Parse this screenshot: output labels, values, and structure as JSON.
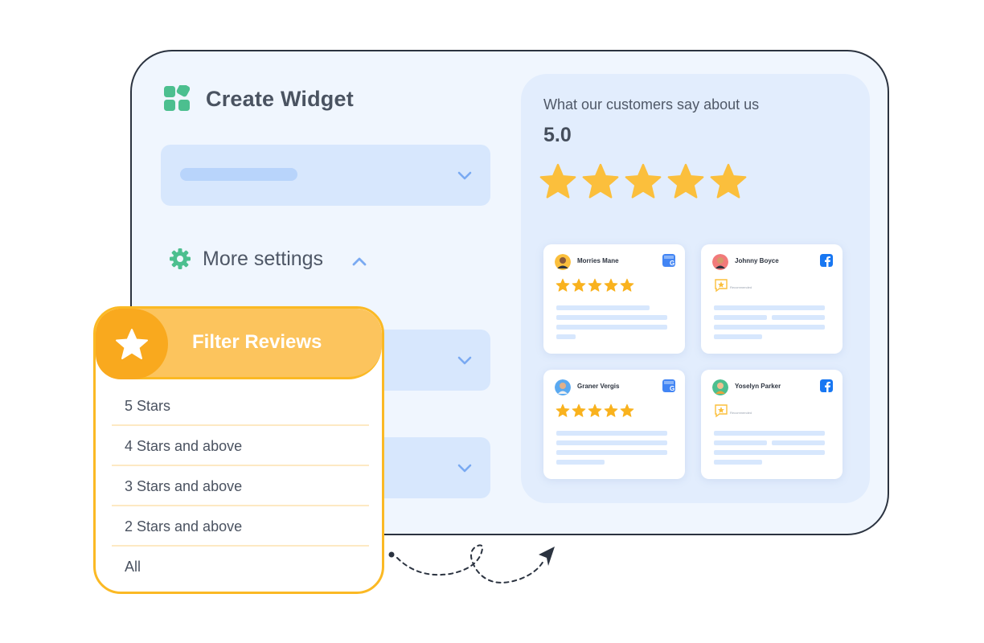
{
  "header": {
    "title": "Create Widget",
    "logo_icon": "widget-grid-icon"
  },
  "settings": {
    "more_settings_label": "More settings",
    "icon": "gear-icon"
  },
  "preview": {
    "heading": "What our customers say about us",
    "score": "5.0",
    "rating": 5,
    "reviews": [
      {
        "name": "Morries Mane",
        "source": "google-my-business-icon",
        "type": "stars",
        "rating": 5
      },
      {
        "name": "Johnny Boyce",
        "source": "facebook-icon",
        "type": "recommendation",
        "recommend_text": "Recommended"
      },
      {
        "name": "Graner Vergis",
        "source": "google-my-business-icon",
        "type": "stars",
        "rating": 5
      },
      {
        "name": "Yoselyn Parker",
        "source": "facebook-icon",
        "type": "recommendation",
        "recommend_text": "Recommended"
      }
    ]
  },
  "filter": {
    "title": "Filter Reviews",
    "icon": "star-icon",
    "options": [
      "5 Stars",
      "4 Stars and above",
      "3 Stars and above",
      "2 Stars and above",
      "All"
    ]
  },
  "colors": {
    "accent_green": "#4cbf8f",
    "accent_orange": "#f9a91e",
    "star_yellow": "#fbbf3c",
    "select_bg": "#d7e7fd",
    "facebook_blue": "#1877f2",
    "google_blue": "#4285f4"
  }
}
